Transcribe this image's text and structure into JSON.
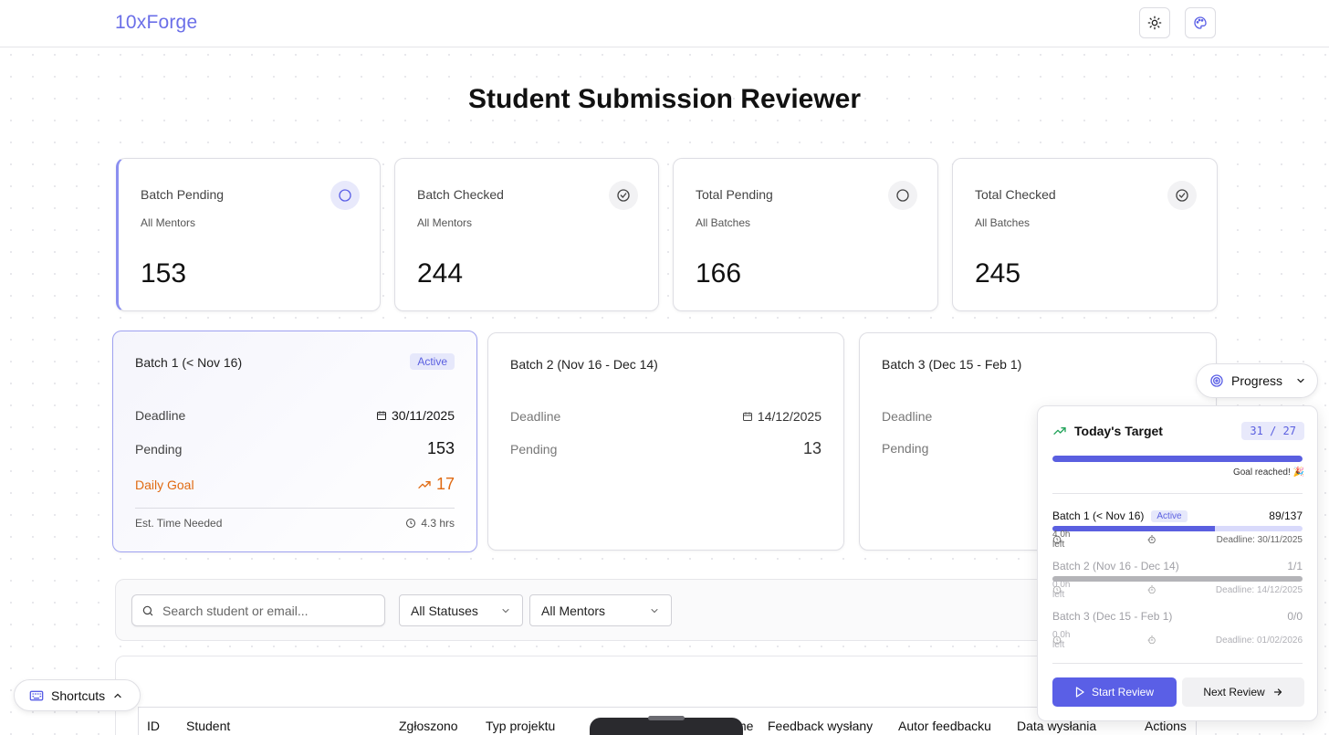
{
  "header": {
    "logo": "10xForge",
    "theme_icon": "sun-icon",
    "palette_icon": "palette-icon"
  },
  "page": {
    "title": "Student Submission Reviewer"
  },
  "stats": [
    {
      "label": "Batch Pending",
      "sub": "All Mentors",
      "value": "153",
      "icon": "circle-icon"
    },
    {
      "label": "Batch Checked",
      "sub": "All Mentors",
      "value": "244",
      "icon": "circle-check-icon"
    },
    {
      "label": "Total Pending",
      "sub": "All Batches",
      "value": "166",
      "icon": "circle-icon"
    },
    {
      "label": "Total Checked",
      "sub": "All Batches",
      "value": "245",
      "icon": "circle-check-icon"
    }
  ],
  "batches": [
    {
      "title": "Batch 1 (< Nov 16)",
      "badge": "Active",
      "deadline_label": "Deadline",
      "deadline": "30/11/2025",
      "pending_label": "Pending",
      "pending": "153",
      "goal_label": "Daily Goal",
      "goal": "17",
      "time_label": "Est. Time Needed",
      "time": "4.3 hrs"
    },
    {
      "title": "Batch 2 (Nov 16 - Dec 14)",
      "deadline_label": "Deadline",
      "deadline": "14/12/2025",
      "pending_label": "Pending",
      "pending": "13"
    },
    {
      "title": "Batch 3 (Dec 15 - Feb 1)",
      "deadline_label": "Deadline",
      "pending_label": "Pending"
    }
  ],
  "filters": {
    "search_placeholder": "Search student or email...",
    "status": "All Statuses",
    "mentor": "All Mentors"
  },
  "table": {
    "columns": [
      "ID",
      "Student",
      "Zgłoszono",
      "Typ projektu",
      "Feedback wysłany",
      "Autor feedbacku",
      "Data wysłania",
      "Actions"
    ],
    "partial_column": "me"
  },
  "shortcuts": {
    "label": "Shortcuts"
  },
  "progress": {
    "toggle_label": "Progress",
    "title": "Today's Target",
    "done": 31,
    "target": 27,
    "count_text": "31 / 27",
    "goal_note": "Goal reached! 🎉",
    "batches": [
      {
        "name": "Batch 1 (< Nov 16)",
        "badge": "Active",
        "count": "89/137",
        "fraction": 0.65,
        "left": "4.0h left",
        "eta": "--",
        "deadline": "Deadline: 30/11/2025",
        "dim": false
      },
      {
        "name": "Batch 2 (Nov 16 - Dec 14)",
        "count": "1/1",
        "fraction": 1.0,
        "left": "0.0h left",
        "eta": "--",
        "deadline": "Deadline: 14/12/2025",
        "dim": true
      },
      {
        "name": "Batch 3 (Dec 15 - Feb 1)",
        "count": "0/0",
        "fraction": 0,
        "left": "0.0h left",
        "eta": "--",
        "deadline": "Deadline: 01/02/2026",
        "dim": true
      }
    ],
    "start_label": "Start Review",
    "next_label": "Next Review"
  },
  "colors": {
    "accent": "#5a5fe6",
    "goal": "#e06a12",
    "logo": "#6b6fe8"
  }
}
